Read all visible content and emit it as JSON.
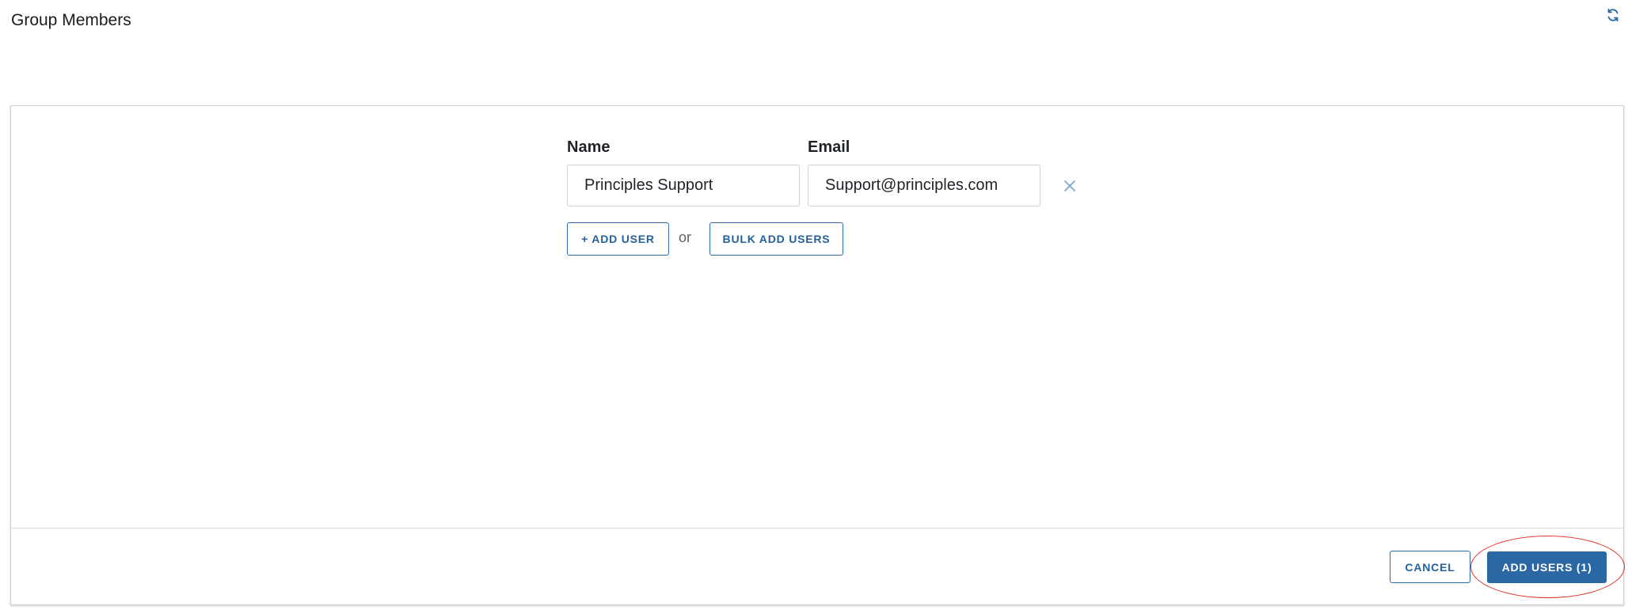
{
  "header": {
    "title": "Group Members",
    "refresh_icon": "refresh-icon"
  },
  "form": {
    "name_label": "Name",
    "email_label": "Email",
    "rows": [
      {
        "name_value": "Principles Support",
        "email_value": "Support@principles.com",
        "remove_icon": "close-icon"
      }
    ],
    "add_user_label": "+ ADD USER",
    "or_text": "or",
    "bulk_add_label": "BULK ADD USERS"
  },
  "footer": {
    "cancel_label": "CANCEL",
    "submit_label": "ADD USERS (1)"
  },
  "colors": {
    "accent": "#2a67a3",
    "highlight": "#e0322b"
  }
}
